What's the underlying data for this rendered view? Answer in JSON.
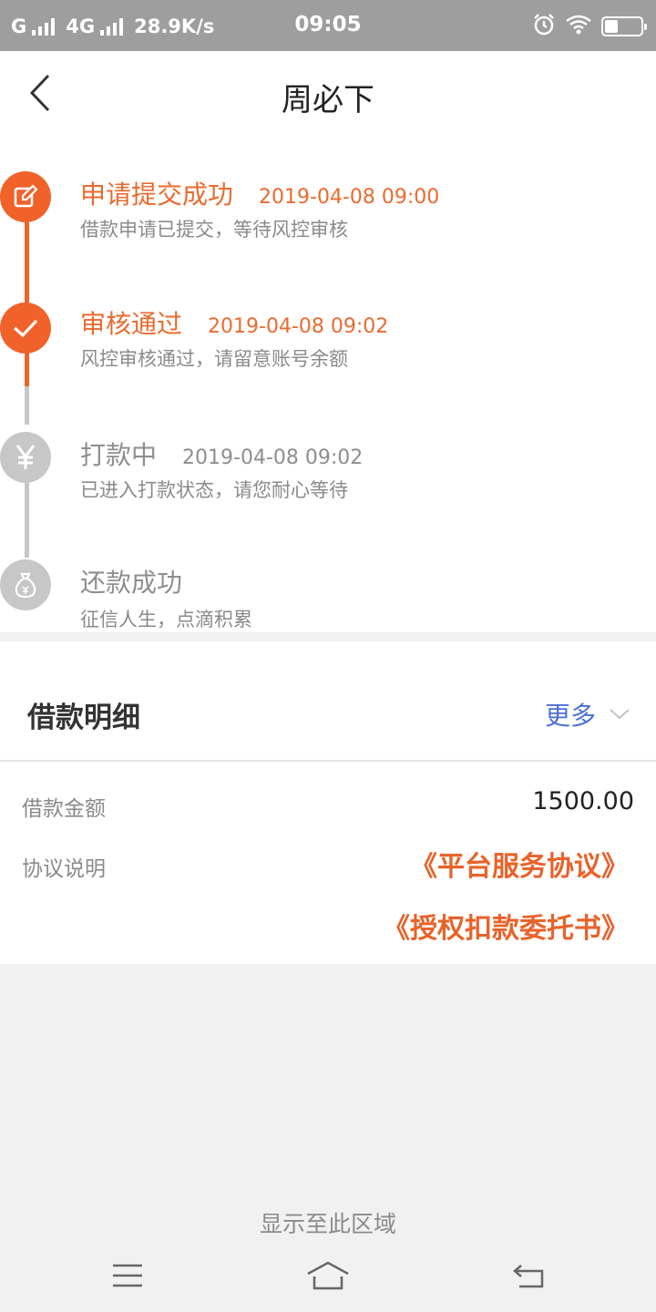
{
  "status_bar": {
    "carrier1": "G",
    "carrier2": "4G",
    "net_speed": "28.9K/s",
    "time": "09:05"
  },
  "header": {
    "title": "周必下"
  },
  "timeline": {
    "steps": [
      {
        "title": "申请提交成功",
        "time": "2019-04-08 09:00",
        "desc": "借款申请已提交，等待风控审核",
        "state": "done",
        "icon": "edit-icon"
      },
      {
        "title": "审核通过",
        "time": "2019-04-08 09:02",
        "desc": "风控审核通过，请留意账号余额",
        "state": "done",
        "icon": "check-icon"
      },
      {
        "title": "打款中",
        "time": "2019-04-08 09:02",
        "desc": "已进入打款状态，请您耐心等待",
        "state": "pending",
        "icon": "yen-icon"
      },
      {
        "title": "还款成功",
        "time": "",
        "desc": "征信人生，点滴积累",
        "state": "pending",
        "icon": "money-bag-icon"
      }
    ]
  },
  "loan_detail": {
    "title": "借款明细",
    "more_label": "更多",
    "amount_label": "借款金额",
    "amount_value": "1500.00",
    "agreement_label": "协议说明",
    "agreements": [
      "《平台服务协议》",
      "《授权扣款委托书》"
    ]
  },
  "bottom": {
    "hint": "显示至此区域"
  },
  "colors": {
    "accent": "#f0622a",
    "link_blue": "#4a6fd6",
    "inactive": "#c7c7c7"
  }
}
